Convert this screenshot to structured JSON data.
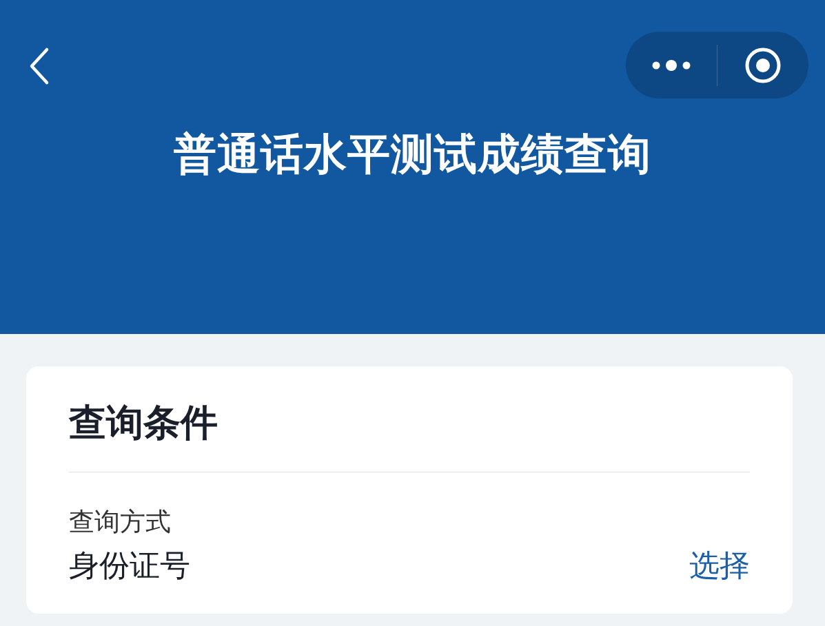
{
  "header": {
    "title": "普通话水平测试成绩查询"
  },
  "card": {
    "title": "查询条件",
    "fields": [
      {
        "label": "查询方式",
        "value": "身份证号",
        "action": "选择"
      }
    ]
  }
}
